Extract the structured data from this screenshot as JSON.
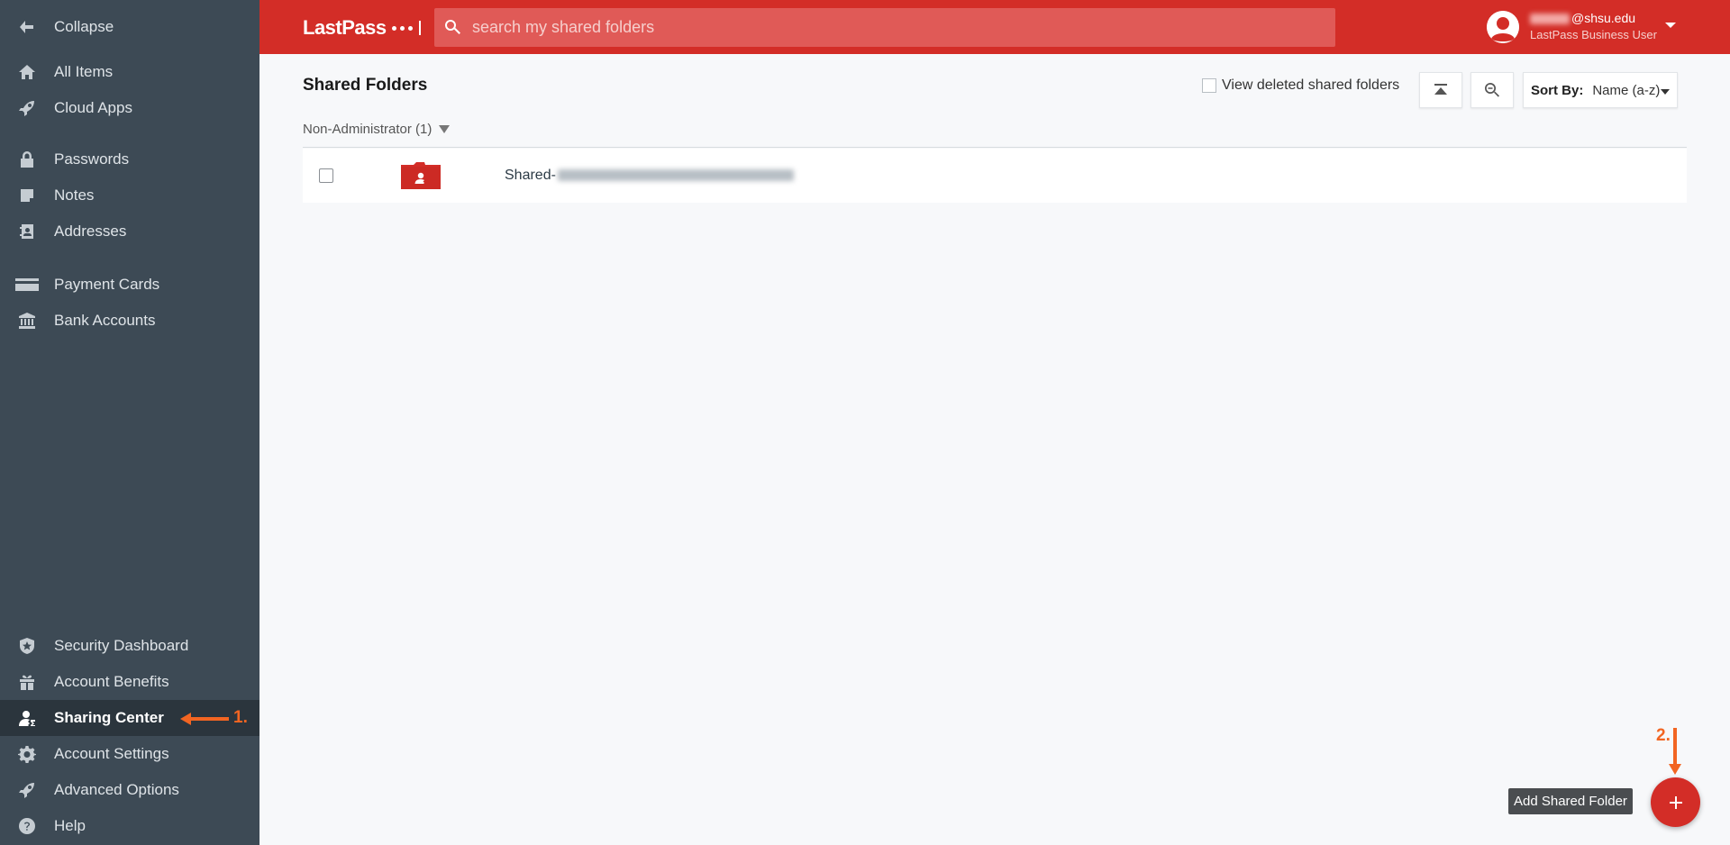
{
  "sidebar": {
    "items": [
      {
        "label": "Collapse",
        "icon": "arrow-left-icon"
      },
      {
        "label": "All Items",
        "icon": "home-icon"
      },
      {
        "label": "Cloud Apps",
        "icon": "rocket-icon"
      },
      {
        "label": "Passwords",
        "icon": "lock-icon"
      },
      {
        "label": "Notes",
        "icon": "note-icon"
      },
      {
        "label": "Addresses",
        "icon": "address-book-icon"
      },
      {
        "label": "Payment Cards",
        "icon": "credit-card-icon"
      },
      {
        "label": "Bank Accounts",
        "icon": "bank-icon"
      },
      {
        "label": "Security Dashboard",
        "icon": "shield-star-icon"
      },
      {
        "label": "Account Benefits",
        "icon": "gift-icon"
      },
      {
        "label": "Sharing Center",
        "icon": "user-share-icon",
        "active": true
      },
      {
        "label": "Account Settings",
        "icon": "gear-icon"
      },
      {
        "label": "Advanced Options",
        "icon": "rocket-icon"
      },
      {
        "label": "Help",
        "icon": "question-icon"
      }
    ]
  },
  "header": {
    "logo_text": "LastPass",
    "search_placeholder": "search my shared folders",
    "user_email_visible": "@shsu.edu",
    "user_role": "LastPass Business User"
  },
  "main": {
    "title": "Shared Folders",
    "view_deleted_label": "View deleted shared folders",
    "sort_label": "Sort By:",
    "sort_value": "Name (a-z)",
    "group_label": "Non-Administrator (1)",
    "rows": [
      {
        "name_prefix": "Shared-"
      }
    ],
    "add_tooltip": "Add Shared Folder"
  },
  "annotations": {
    "step1": "1.",
    "step2": "2."
  },
  "colors": {
    "brand_red": "#d32d27",
    "sidebar_bg": "#3d4a55",
    "annotation_orange": "#f26522"
  }
}
